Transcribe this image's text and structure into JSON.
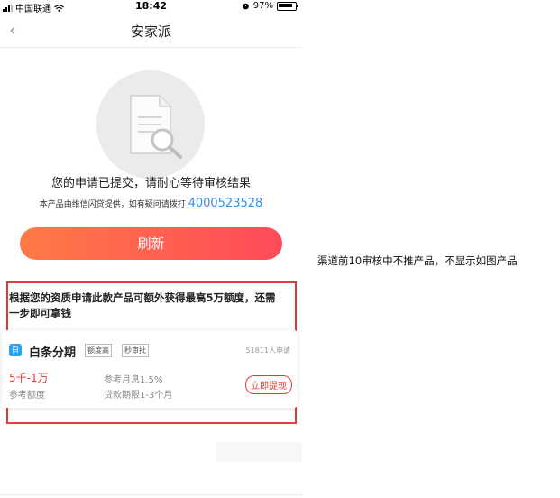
{
  "statusbar": {
    "carrier": "中国联通",
    "time": "18:42",
    "battery": "97%"
  },
  "nav": {
    "title": "安家派"
  },
  "status": {
    "message": "您的申请已提交，请耐心等待审核结果",
    "provider_text": "本产品由维信闪贷提供，如有疑问请拨打",
    "hotline": "4000523528",
    "refresh_label": "刷新"
  },
  "promo": {
    "line1": "根据您的资质申请此款产品可额外获得最高5万额度，还需",
    "line2": "一步即可拿钱"
  },
  "product": {
    "logo_text": "白条",
    "name": "白条分期",
    "tags": [
      "额度高",
      "秒审批"
    ],
    "applicants": "51811人申请",
    "amount": "5千-1万",
    "amount_label": "参考额度",
    "rate": "参考月息1.5%",
    "period": "贷款期限1-3个月",
    "action_label": "立即提现"
  },
  "annotation": "渠道前10审核中不推产品，不显示如图产品",
  "colors": {
    "accent_red": "#e53935",
    "link_blue": "#3a8fe0",
    "gradient_start": "#ff7a45",
    "gradient_end": "#ff4a5a"
  }
}
